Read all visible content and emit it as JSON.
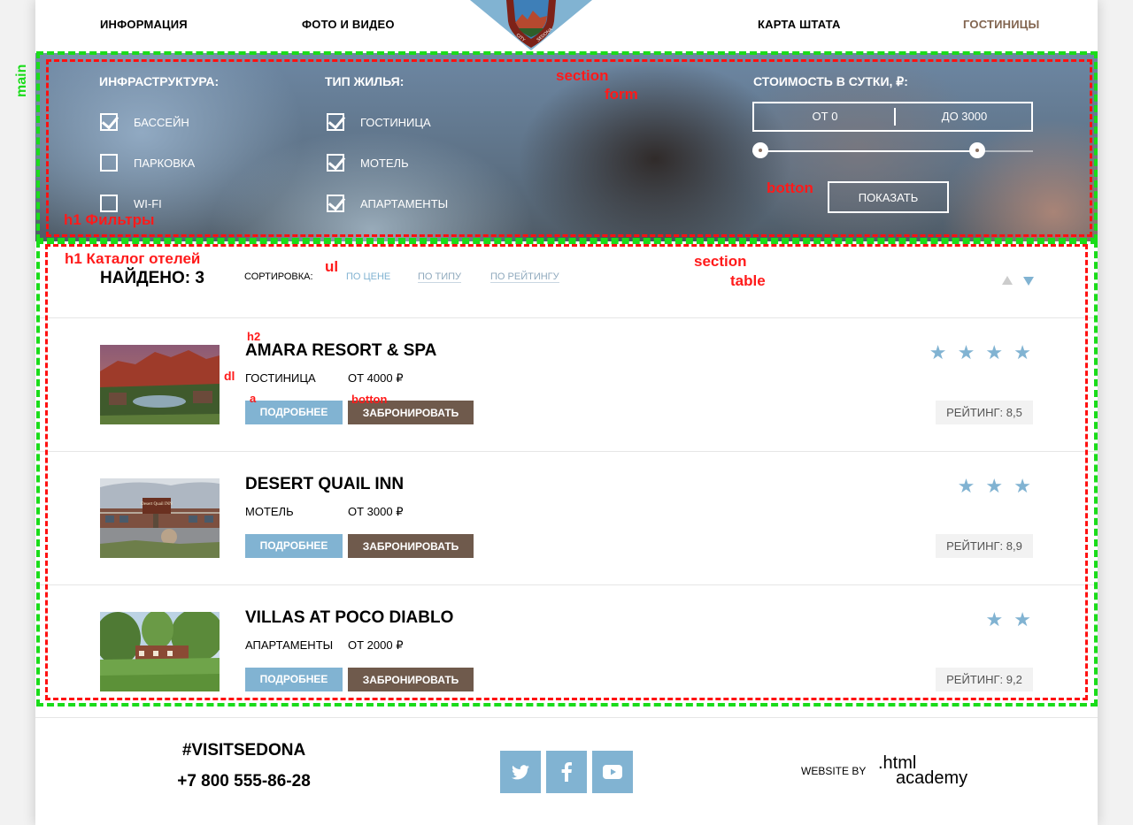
{
  "nav": {
    "items": [
      {
        "label": "ИНФОРМАЦИЯ"
      },
      {
        "label": "ФОТО И ВИДЕО"
      },
      {
        "label": "КАРТА ШТАТА"
      },
      {
        "label": "ГОСТИНИЦЫ"
      }
    ],
    "logo_text": "CITY OF SEDONA"
  },
  "annotations": {
    "main": "main",
    "section_form": "section",
    "form": "form",
    "botton_filter": "botton",
    "h1_filters": "h1 Фильтры",
    "h1_catalog": "h1 Каталог отелей",
    "ul": "ul",
    "section_table": "section",
    "table": "table",
    "h2": "h2",
    "dl": "dl",
    "a": "a",
    "botton_card": "botton"
  },
  "filters": {
    "infrastructure": {
      "heading": "ИНФРАСТРУКТУРА:",
      "options": [
        {
          "label": "БАССЕЙН",
          "checked": true
        },
        {
          "label": "ПАРКОВКА",
          "checked": false
        },
        {
          "label": "WI-FI",
          "checked": false
        }
      ]
    },
    "housing": {
      "heading": "ТИП ЖИЛЬЯ:",
      "options": [
        {
          "label": "ГОСТИНИЦА",
          "checked": true
        },
        {
          "label": "МОТЕЛЬ",
          "checked": true
        },
        {
          "label": "АПАРТАМЕНТЫ",
          "checked": true
        }
      ]
    },
    "price": {
      "heading": "СТОИМОСТЬ В СУТКИ, ₽:",
      "from": "ОТ 0",
      "to": "ДО 3000",
      "range_min_fraction": 0.0,
      "range_max_fraction": 0.8
    },
    "show_label": "ПОКАЗАТЬ"
  },
  "catalog": {
    "found": "НАЙДЕНО: 3",
    "sort_label": "СОРТИРОВКА:",
    "sort_options": [
      "ПО ЦЕНЕ",
      "ПО ТИПУ",
      "ПО РЕЙТИНГУ"
    ],
    "hotels": [
      {
        "name": "AMARA RESORT & SPA",
        "type": "ГОСТИНИЦА",
        "price": "ОТ 4000 ₽",
        "stars": "★ ★ ★ ★",
        "rating": "РЕЙТИНГ: 8,5",
        "more": "ПОДРОБНЕЕ",
        "book": "ЗАБРОНИРОВАТЬ"
      },
      {
        "name": "DESERT QUAIL INN",
        "type": "МОТЕЛЬ",
        "price": "ОТ 3000 ₽",
        "stars": "★ ★ ★",
        "rating": "РЕЙТИНГ: 8,9",
        "more": "ПОДРОБНЕЕ",
        "book": "ЗАБРОНИРОВАТЬ",
        "sign_text": "Desert Quail INN"
      },
      {
        "name": "VILLAS AT POCO DIABLO",
        "type": "АПАРТАМЕНТЫ",
        "price": "ОТ 2000 ₽",
        "stars": "★ ★",
        "rating": "РЕЙТИНГ: 9,2",
        "more": "ПОДРОБНЕЕ",
        "book": "ЗАБРОНИРОВАТЬ"
      }
    ]
  },
  "footer": {
    "hashtag": "#VISITSEDONA",
    "phone": "+7 800 555-86-28",
    "website_by": "WEBSITE BY",
    "academy_line1": ".html",
    "academy_line2": "academy",
    "social": [
      "twitter-icon",
      "facebook-icon",
      "youtube-icon"
    ]
  },
  "colors": {
    "accent_blue": "#81b3d2",
    "brown": "#6f5a4c",
    "active_nav": "#826550",
    "annotation_red": "#ff1111",
    "annotation_green": "#1adc1a"
  }
}
